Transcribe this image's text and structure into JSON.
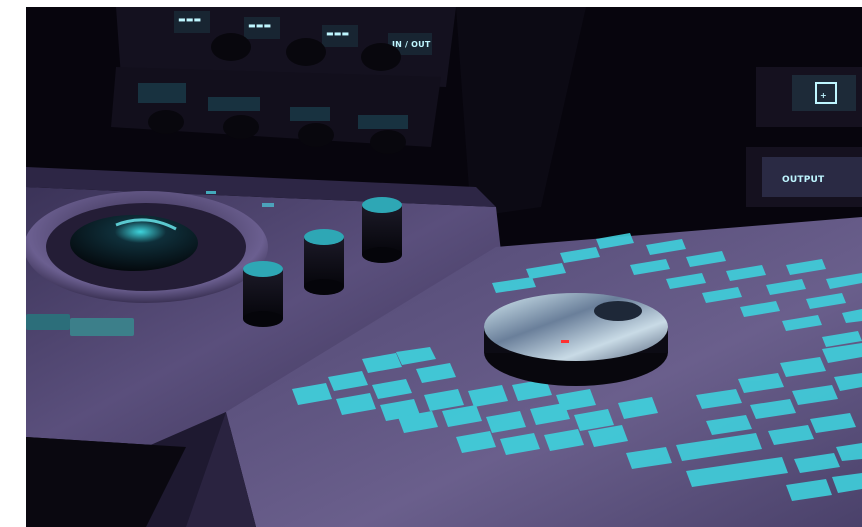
{
  "photo": {
    "subject": "color grading control panel",
    "accent_color": "#4de3f0",
    "body_color": "#4a3f6a",
    "background_color": "#06040c"
  },
  "screen_labels": {
    "top_row": [
      "",
      "",
      "",
      "IN / OUT"
    ],
    "second_row": [
      "",
      "",
      "",
      ""
    ],
    "right_output": "OUTPUT"
  }
}
